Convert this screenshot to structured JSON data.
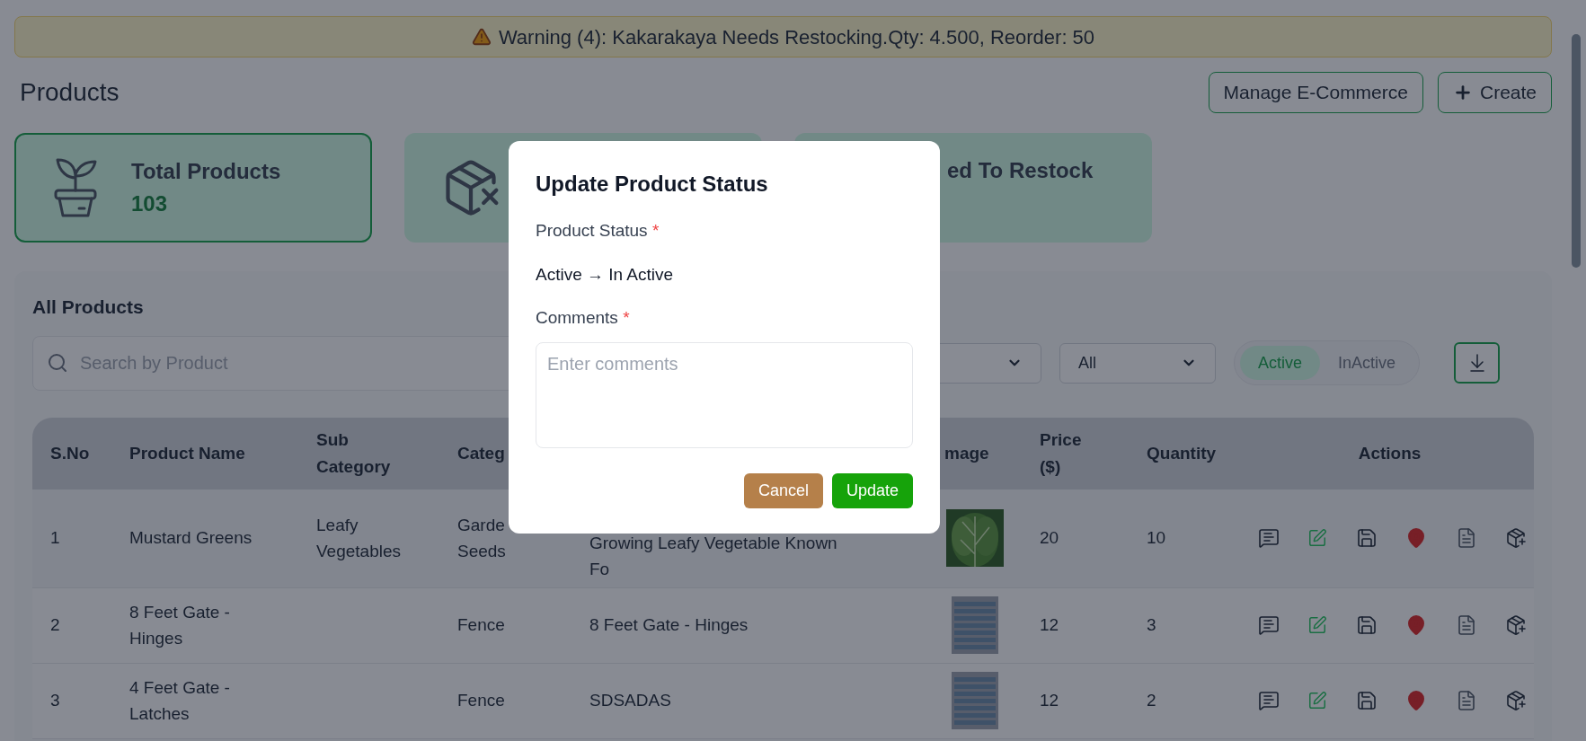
{
  "warning": "Warning (4): Kakarakaya Needs Restocking.Qty: 4.500, Reorder: 50",
  "page_title": "Products",
  "header_buttons": [
    {
      "kind": "plain",
      "label": "Manage E-Commerce"
    },
    {
      "kind": "create",
      "label": "Create"
    }
  ],
  "stat_cards": [
    {
      "kind": "plant",
      "title": "Total Products",
      "value": "103"
    },
    {
      "kind": "box"
    },
    {
      "kind": "none",
      "title": "ed To Restock"
    }
  ],
  "panel_title": "All Products",
  "search": {
    "placeholder": "Search by Product"
  },
  "filters": [
    {
      "kind": "select"
    },
    {
      "kind": "select",
      "value": "All"
    }
  ],
  "status_toggle": [
    {
      "label": "Active",
      "selected": true
    },
    {
      "label": "InActive",
      "selected": false
    }
  ],
  "table": {
    "columns": [
      "S.No",
      "Product Name",
      "Sub Category",
      "Categ",
      "",
      "mage",
      "Price ($)",
      "Quantity",
      "Actions"
    ],
    "rows": [
      {
        "sno": "1",
        "name": "Mustard Greens",
        "sub_category": "Leafy Vegetables",
        "category": "Garde Seeds",
        "description": [
          "Growing Leafy Vegetable Known",
          "Fo"
        ],
        "price": "20",
        "quantity": "10"
      },
      {
        "sno": "2",
        "name": "8 Feet Gate - Hinges",
        "sub_category": "",
        "category": "Fence",
        "description": [
          "8 Feet Gate - Hinges"
        ],
        "price": "12",
        "quantity": "3"
      },
      {
        "sno": "3",
        "name": "4 Feet Gate - Latches",
        "sub_category": "",
        "category": "Fence",
        "description": [
          "SDSADAS"
        ],
        "price": "12",
        "quantity": "2"
      }
    ]
  },
  "modal": {
    "title": "Update Product Status",
    "fields": [
      {
        "label": "Product Status",
        "mark": "*",
        "value": "Active → In Active"
      },
      {
        "label": "Comments",
        "mark": "*",
        "placeholder": "Enter comments"
      }
    ],
    "buttons": [
      {
        "kind": "cancel",
        "label": "Cancel"
      },
      {
        "kind": "primary",
        "label": "Update"
      }
    ]
  }
}
